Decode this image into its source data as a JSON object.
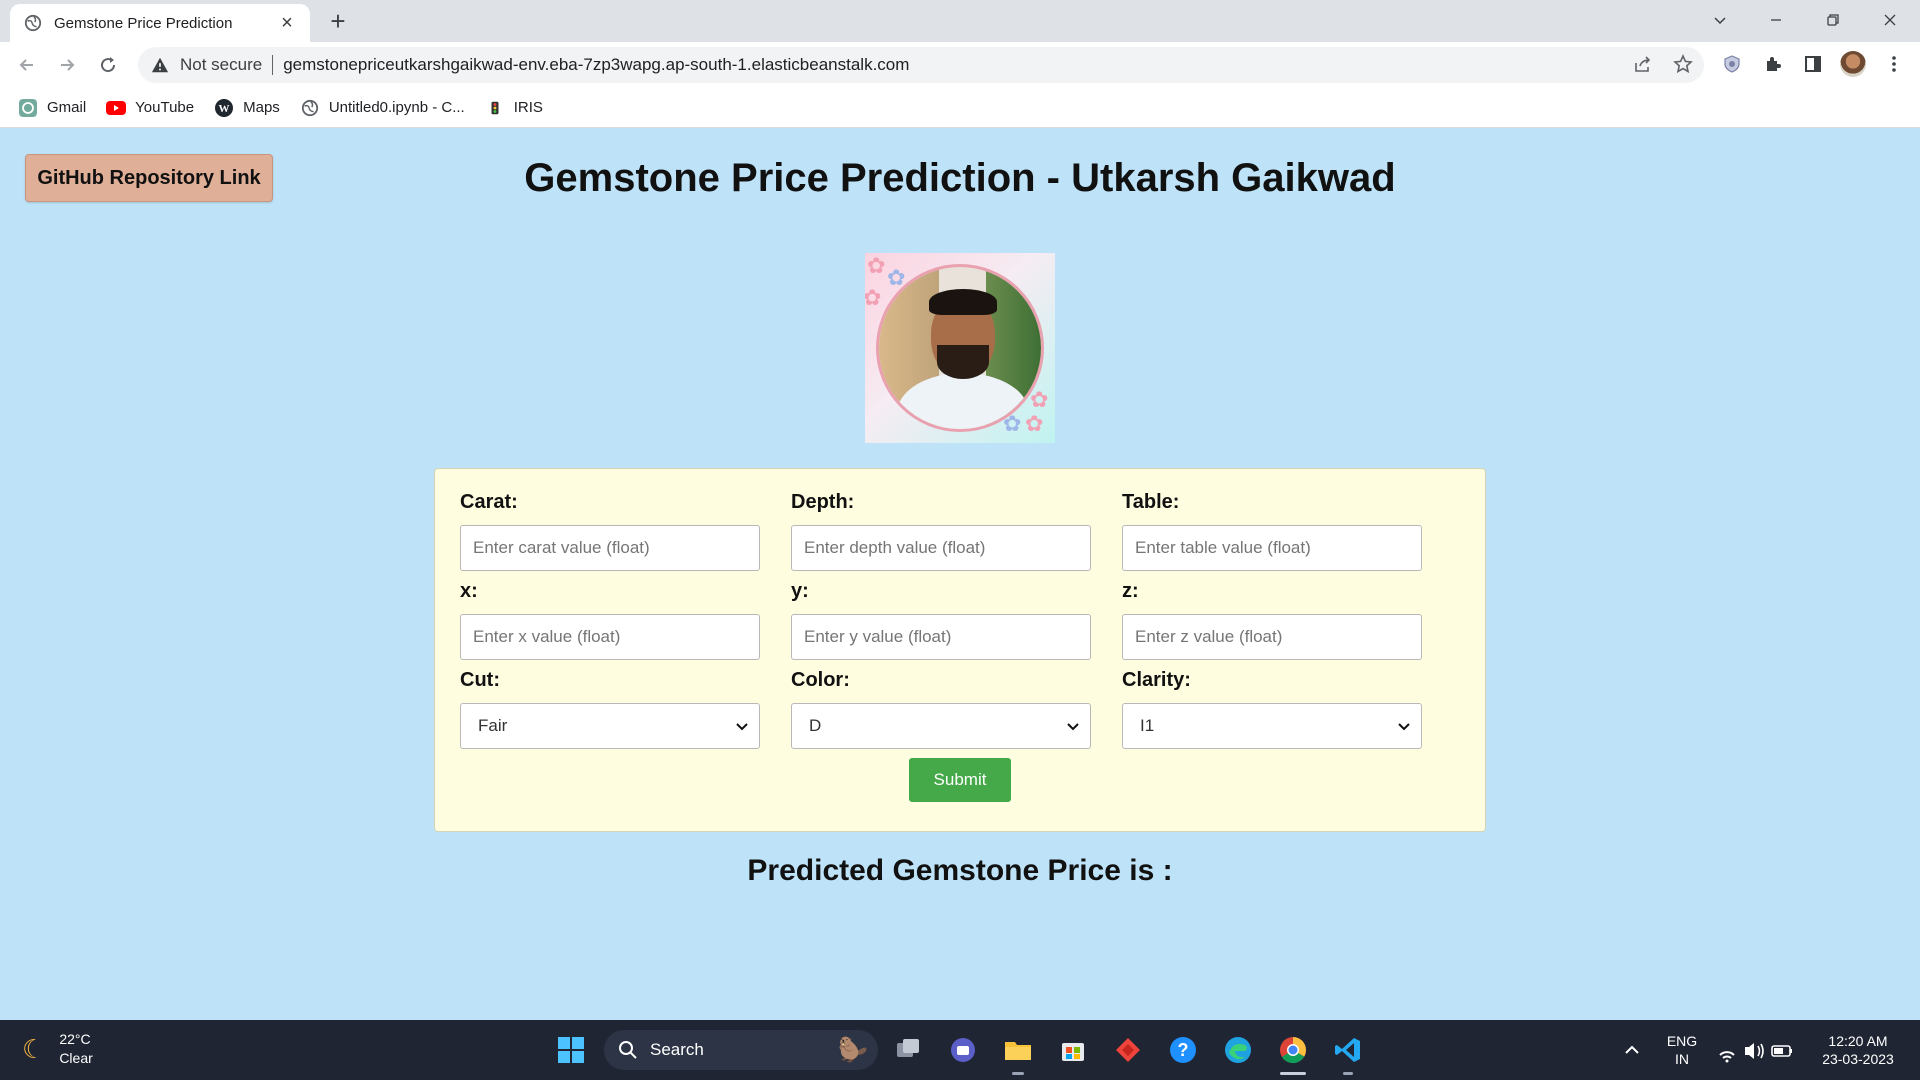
{
  "browser": {
    "tab_title": "Gemstone Price Prediction",
    "new_tab": "+",
    "security_label": "Not secure",
    "url": "gemstonepriceutkarshgaikwad-env.eba-7zp3wapg.ap-south-1.elasticbeanstalk.com",
    "bookmarks": [
      {
        "label": "Gmail",
        "icon": "chatgpt-icon"
      },
      {
        "label": "YouTube",
        "icon": "youtube-icon"
      },
      {
        "label": "Maps",
        "icon": "wordpress-icon"
      },
      {
        "label": "Untitled0.ipynb - C...",
        "icon": "globe-icon"
      },
      {
        "label": "IRIS",
        "icon": "traffic-light-icon"
      }
    ]
  },
  "page": {
    "github_button": "GitHub Repository Link",
    "title": "Gemstone Price Prediction - Utkarsh Gaikwad",
    "fields": {
      "carat": {
        "label": "Carat:",
        "placeholder": "Enter carat value (float)"
      },
      "depth": {
        "label": "Depth:",
        "placeholder": "Enter depth value (float)"
      },
      "table": {
        "label": "Table:",
        "placeholder": "Enter table value (float)"
      },
      "x": {
        "label": "x:",
        "placeholder": "Enter x value (float)"
      },
      "y": {
        "label": "y:",
        "placeholder": "Enter y value (float)"
      },
      "z": {
        "label": "z:",
        "placeholder": "Enter z value (float)"
      },
      "cut": {
        "label": "Cut:",
        "value": "Fair"
      },
      "color": {
        "label": "Color:",
        "value": "D"
      },
      "clarity": {
        "label": "Clarity:",
        "value": "I1"
      }
    },
    "submit": "Submit",
    "result": "Predicted Gemstone Price is :"
  },
  "taskbar": {
    "temperature": "22°C",
    "condition": "Clear",
    "search": "Search",
    "language": "ENG",
    "region": "IN",
    "time": "12:20 AM",
    "date": "23-03-2023"
  },
  "colors": {
    "page_background": "#bee3f8",
    "form_background": "#fffde0",
    "github_button": "#e0af98",
    "submit_button": "#45a849"
  }
}
